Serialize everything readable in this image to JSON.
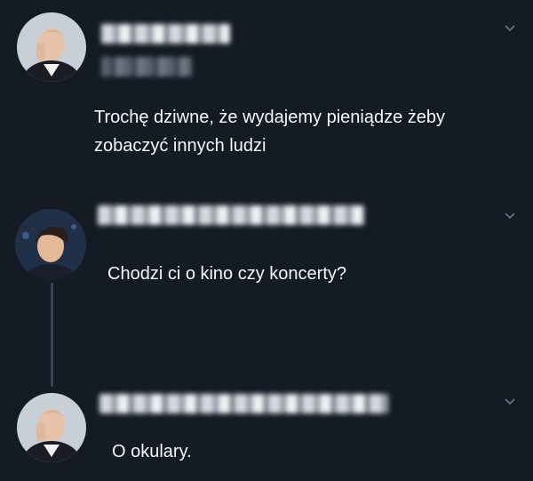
{
  "tweets": [
    {
      "text": "Trochę dziwne, że wydajemy pieniądze żeby\nzobaczyć innych ludzi"
    },
    {
      "text": "Chodzi ci o kino czy koncerty?"
    },
    {
      "text": "O okulary."
    }
  ],
  "icons": {
    "chevron": "chevron-down-icon",
    "avatar": "avatar"
  },
  "colors": {
    "background": "#151b25",
    "text": "#f5f7fa",
    "thread_line": "#384150",
    "chevron": "#6b7585"
  }
}
